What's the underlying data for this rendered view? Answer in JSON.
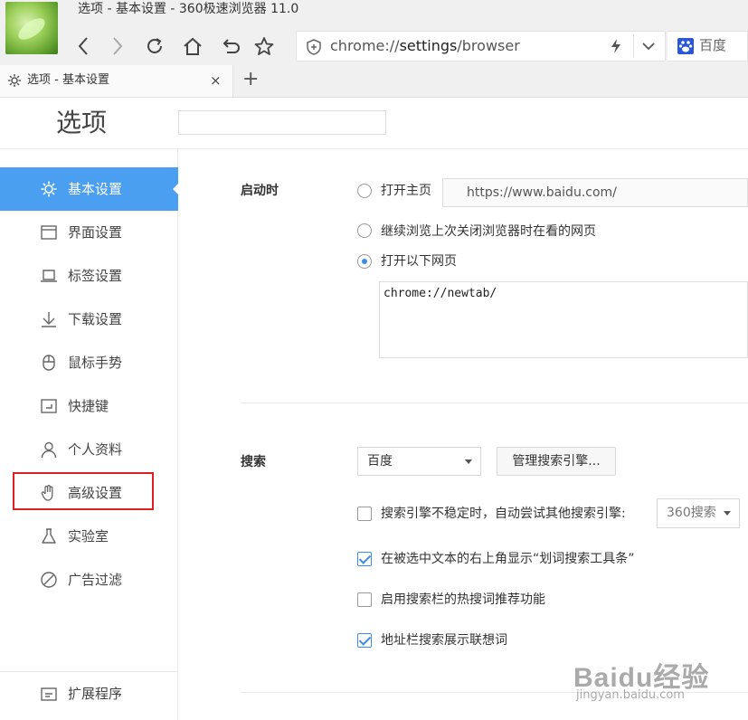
{
  "window": {
    "title": "选项 - 基本设置 - 360极速浏览器 11.0"
  },
  "toolbar": {
    "url_prefix": "chrome://",
    "url_bold": "settings",
    "url_suffix": "/browser",
    "search_engine_label": "百度"
  },
  "tabs": [
    {
      "title": "选项 - 基本设置",
      "close": "×"
    }
  ],
  "new_tab_label": "+",
  "settings": {
    "title": "选项",
    "search_placeholder": ""
  },
  "sidebar": {
    "items": [
      {
        "label": "基本设置",
        "icon": "gear-icon",
        "active": true
      },
      {
        "label": "界面设置",
        "icon": "window-icon"
      },
      {
        "label": "标签设置",
        "icon": "tab-icon"
      },
      {
        "label": "下载设置",
        "icon": "download-icon"
      },
      {
        "label": "鼠标手势",
        "icon": "mouse-icon"
      },
      {
        "label": "快捷键",
        "icon": "shortcut-icon"
      },
      {
        "label": "个人资料",
        "icon": "person-icon"
      },
      {
        "label": "高级设置",
        "icon": "hand-icon"
      },
      {
        "label": "实验室",
        "icon": "flask-icon"
      },
      {
        "label": "广告过滤",
        "icon": "block-icon"
      }
    ],
    "footer_label": "扩展程序"
  },
  "startup": {
    "label": "启动时",
    "open_home_label": "打开主页",
    "home_url": "https://www.baidu.com/",
    "continue_label": "继续浏览上次关闭浏览器时在看的网页",
    "open_pages_label": "打开以下网页",
    "pages_value": "chrome://newtab/"
  },
  "search": {
    "label": "搜索",
    "engine_value": "百度",
    "manage_button": "管理搜索引擎...",
    "fallback_label": "搜索引擎不稳定时，自动尝试其他搜索引擎:",
    "fallback_value": "360搜索",
    "show_toolbar_label": "在被选中文本的右上角显示“划词搜索工具条”",
    "hot_words_label": "启用搜索栏的热搜词推荐功能",
    "suggest_label": "地址栏搜索展示联想词"
  },
  "watermark": {
    "brand": "Baidu经验",
    "url": "jingyan.baidu.com"
  },
  "colors": {
    "accent": "#4a9ff0",
    "highlight": "#e02020"
  }
}
